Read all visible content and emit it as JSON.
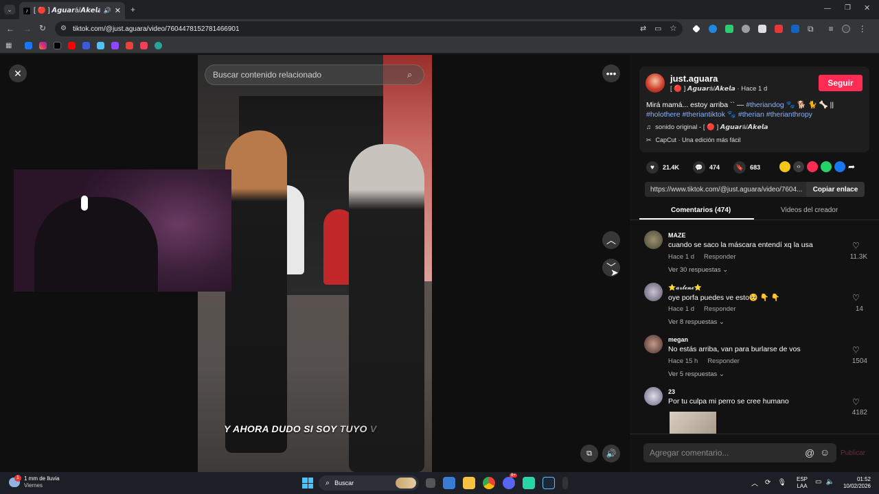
{
  "browser": {
    "tab_title": "[ 🔴 ] 𝘼𝙜𝙪𝙖𝙧á/𝘼𝙠𝙚𝙡𝙖 (@just.",
    "url": "tiktok.com/@just.aguara/video/7604478152781466901",
    "colors": {
      "tabbar": "#1f2125",
      "toolbar": "#35363a"
    }
  },
  "video": {
    "search_placeholder": "Buscar contenido relacionado",
    "subtitle_main": "Y AHORA DUDO SI SOY ",
    "subtitle_highlight": "TUYO",
    "subtitle_tail": " V"
  },
  "post": {
    "username": "just.aguara",
    "display_name": "[ 🔴 ] 𝘼𝙜𝙪𝙖𝙧á/𝘼𝙠𝙚𝙡𝙖",
    "time_sep": " · ",
    "time": "Hace 1 d",
    "follow_label": "Seguir",
    "caption_start": "Mirá mamá... estoy arriba `` — ",
    "hashtags_line1": "#theriandog",
    "caption_emojis": " 🐾 🐕 🐈 🦴 ||",
    "hashtags_line2a": "#holothere #theriantiktok",
    "hashtags_line2b": "#therian #therianthropy",
    "sound": "sonido original - [ 🔴 ] 𝘼𝙜𝙪𝙖𝙧á/𝘼𝙠𝙚𝙡𝙖",
    "capcut": "CapCut · Una edición más fácil",
    "likes": "21.4K",
    "comments": "474",
    "saves": "683",
    "link": "https://www.tiktok.com/@just.aguara/video/7604...",
    "copy_label": "Copiar enlace",
    "tab_comments": "Comentarios (474)",
    "tab_creator": "Videos del creador",
    "accent": "#fe2c55"
  },
  "comments": [
    {
      "user": "MAZE",
      "text": "cuando se saco la máscara entendí xq la usa",
      "time": "Hace 1 d",
      "reply": "Responder",
      "replies": "Ver 30 respuestas",
      "likes": "11.3K"
    },
    {
      "user": "⭐𝓪𝓻𝓵𝓮𝓷𝓮⭐",
      "text": "oye porfa puedes ve esto🥺 👇 👇",
      "time": "Hace 1 d",
      "reply": "Responder",
      "replies": "Ver 8 respuestas",
      "likes": "14"
    },
    {
      "user": "megan",
      "text": "No estás arriba, van para burlarse de vos",
      "time": "Hace 15 h",
      "reply": "Responder",
      "replies": "Ver 5 respuestas",
      "likes": "1504"
    },
    {
      "user": "23",
      "text": "Por tu culpa mi perro se cree humano",
      "likes": "4182"
    }
  ],
  "composer": {
    "placeholder": "Agregar comentario...",
    "publish": "Publicar"
  },
  "taskbar": {
    "weather_main": "1 mm de lluvia",
    "weather_day": "Viernes",
    "search": "Buscar",
    "lang1": "ESP",
    "lang2": "LAA",
    "time": "01:52",
    "date": "10/02/2026",
    "discord_badge": "9+",
    "weather_badge": "1"
  }
}
